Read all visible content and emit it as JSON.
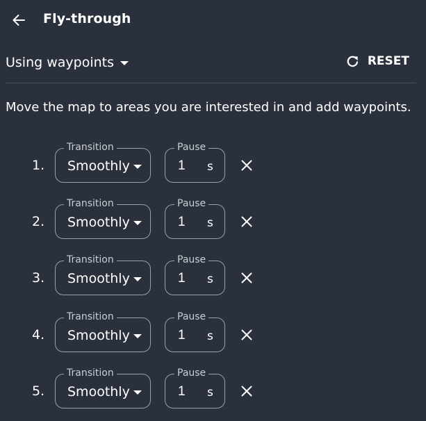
{
  "header": {
    "title": "Fly-through",
    "back_icon": "arrow-left-icon"
  },
  "mode": {
    "selected": "Using waypoints"
  },
  "reset": {
    "label": "RESET",
    "icon": "refresh-icon"
  },
  "instructions": "Move the map to areas you are interested in and add waypoints.",
  "waypoint_labels": {
    "transition": "Transition",
    "pause": "Pause",
    "unit": "s"
  },
  "waypoints": [
    {
      "number": "1.",
      "transition": "Smoothly",
      "pause": "1"
    },
    {
      "number": "2.",
      "transition": "Smoothly",
      "pause": "1"
    },
    {
      "number": "3.",
      "transition": "Smoothly",
      "pause": "1"
    },
    {
      "number": "4.",
      "transition": "Smoothly",
      "pause": "1"
    },
    {
      "number": "5.",
      "transition": "Smoothly",
      "pause": "1"
    }
  ],
  "colors": {
    "background": "#2b313c",
    "text": "#ffffff",
    "field_border": "#9aa0a8",
    "divider": "#4a515c"
  }
}
